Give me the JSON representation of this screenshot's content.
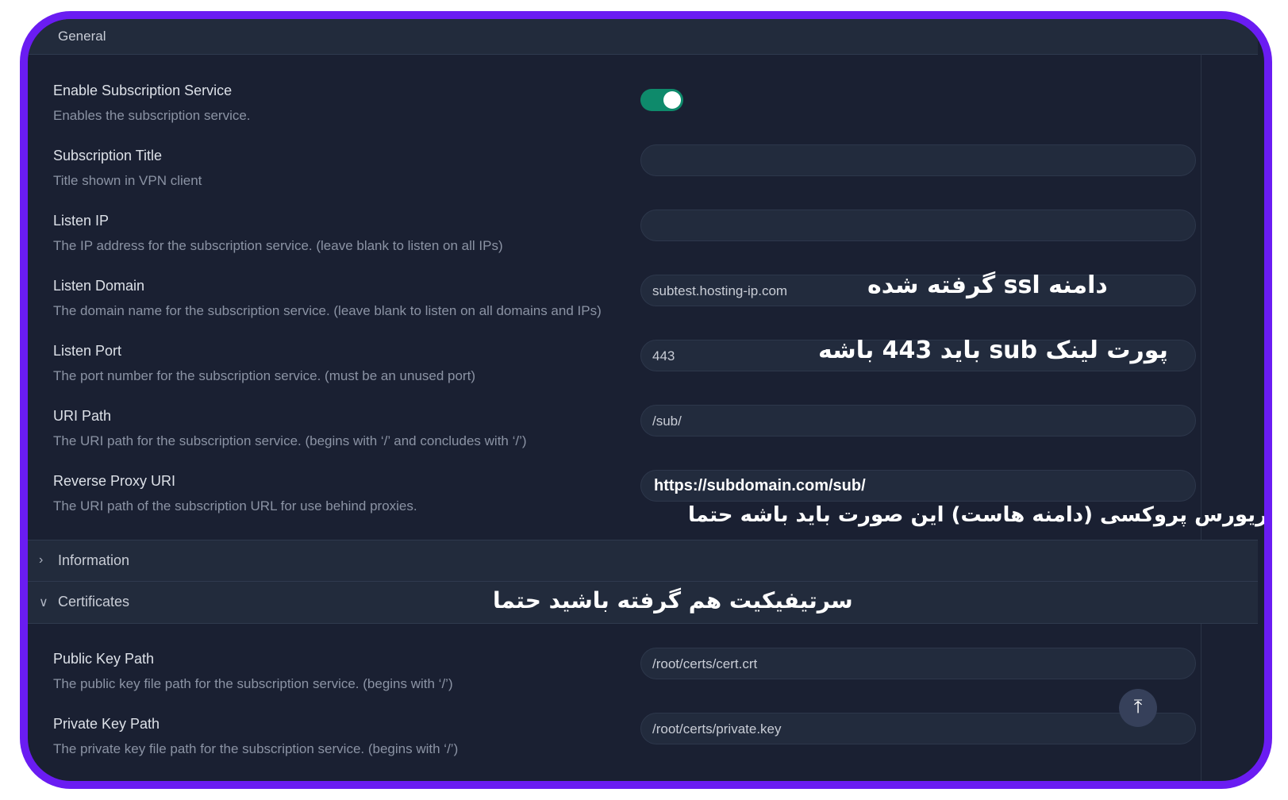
{
  "header": {
    "section_label": "General"
  },
  "settings": [
    {
      "title": "Enable Subscription Service",
      "desc": "Enables the subscription service."
    },
    {
      "title": "Subscription Title",
      "desc": "Title shown in VPN client",
      "value": ""
    },
    {
      "title": "Listen IP",
      "desc": "The IP address for the subscription service. (leave blank to listen on all IPs)",
      "value": ""
    },
    {
      "title": "Listen Domain",
      "desc": "The domain name for the subscription service. (leave blank to listen on all domains and IPs)",
      "value": "subtest.hosting-ip.com"
    },
    {
      "title": "Listen Port",
      "desc": "The port number for the subscription service. (must be an unused port)",
      "value": "443"
    },
    {
      "title": "URI Path",
      "desc": "The URI path for the subscription service. (begins with ‘/’ and concludes with ‘/’)",
      "value": "/sub/"
    },
    {
      "title": "Reverse Proxy URI",
      "desc": "The URI path of the subscription URL for use behind proxies.",
      "value": "https://subdomain.com/sub/"
    }
  ],
  "toggle_state": "on",
  "sections": {
    "information": "Information",
    "certificates": "Certificates"
  },
  "cert_settings": [
    {
      "title": "Public Key Path",
      "desc": "The public key file path for the subscription service. (begins with ‘/’)",
      "value": "/root/certs/cert.crt"
    },
    {
      "title": "Private Key Path",
      "desc": "The private key file path for the subscription service. (begins with ‘/’)",
      "value": "/root/certs/private.key"
    }
  ],
  "annotations": {
    "domain_note": "دامنه ssl گرفته شده",
    "port_note": "پورت لینک sub باید 443 باشه",
    "proxy_note": "دامنه ریورس پروکسی (دامنه هاست)  این صورت باید باشه حتما",
    "cert_note": "سرتیفیکیت هم گرفته باشید حتما"
  },
  "colors": {
    "border": "#6a1cf2",
    "toggle": "#0e8a6b",
    "background": "#1a2032"
  },
  "icons": {
    "scroll_top": "arrow-up-to-line-icon",
    "expand": "chevron-right-icon",
    "collapse": "chevron-down-icon"
  }
}
